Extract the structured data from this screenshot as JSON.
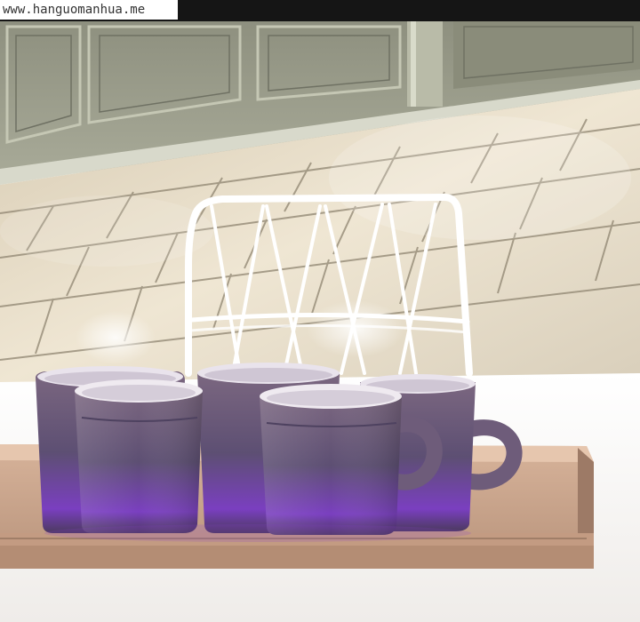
{
  "watermark": {
    "text": "www.hanguomanhua.me"
  },
  "scene": {
    "subject": "mugs-on-tray",
    "colors": {
      "wall": "#9c9e8c",
      "wall_panel_line": "#c8cab8",
      "floor_light": "#e6dcc8",
      "floor_dark": "#b0a48c",
      "chair_frame": "#ffffff",
      "mug_body": "#6a5477",
      "mug_glow": "#8a3fd0",
      "mug_rim": "#efeaf0",
      "tray": "#c9a48a",
      "tray_edge": "#9d7a66",
      "table_white": "#f8f6f4"
    }
  }
}
